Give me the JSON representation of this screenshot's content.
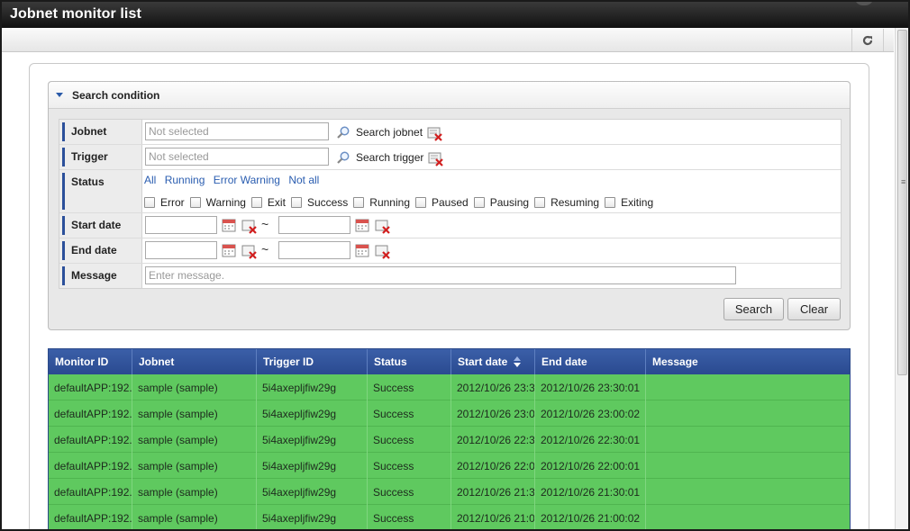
{
  "window": {
    "title": "Jobnet monitor list"
  },
  "search": {
    "header": "Search condition",
    "jobnet": {
      "label": "Jobnet",
      "placeholder": "Not selected",
      "action": "Search jobnet"
    },
    "trigger": {
      "label": "Trigger",
      "placeholder": "Not selected",
      "action": "Search trigger"
    },
    "status": {
      "label": "Status",
      "links": [
        "All",
        "Running",
        "Error Warning",
        "Not all"
      ],
      "checkboxes": [
        "Error",
        "Warning",
        "Exit",
        "Success",
        "Running",
        "Paused",
        "Pausing",
        "Resuming",
        "Exiting"
      ]
    },
    "start_date": {
      "label": "Start date",
      "separator": "~"
    },
    "end_date": {
      "label": "End date",
      "separator": "~"
    },
    "message": {
      "label": "Message",
      "placeholder": "Enter message."
    },
    "search_button": "Search",
    "clear_button": "Clear"
  },
  "grid": {
    "columns": [
      "Monitor ID",
      "Jobnet",
      "Trigger ID",
      "Status",
      "Start date",
      "End date",
      "Message"
    ],
    "row_color": "#5fc95f",
    "header_color": "#2e4f96",
    "rows": [
      [
        "defaultAPP:192.",
        "sample (sample)",
        "5i4axepljfiw29g",
        "Success",
        "2012/10/26 23:3",
        "2012/10/26 23:30:01",
        ""
      ],
      [
        "defaultAPP:192.",
        "sample (sample)",
        "5i4axepljfiw29g",
        "Success",
        "2012/10/26 23:0",
        "2012/10/26 23:00:02",
        ""
      ],
      [
        "defaultAPP:192.",
        "sample (sample)",
        "5i4axepljfiw29g",
        "Success",
        "2012/10/26 22:3",
        "2012/10/26 22:30:01",
        ""
      ],
      [
        "defaultAPP:192.",
        "sample (sample)",
        "5i4axepljfiw29g",
        "Success",
        "2012/10/26 22:0",
        "2012/10/26 22:00:01",
        ""
      ],
      [
        "defaultAPP:192.",
        "sample (sample)",
        "5i4axepljfiw29g",
        "Success",
        "2012/10/26 21:3",
        "2012/10/26 21:30:01",
        ""
      ],
      [
        "defaultAPP:192.",
        "sample (sample)",
        "5i4axepljfiw29g",
        "Success",
        "2012/10/26 21:0",
        "2012/10/26 21:00:02",
        ""
      ]
    ]
  }
}
